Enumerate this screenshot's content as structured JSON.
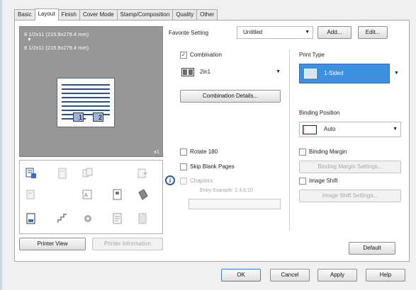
{
  "tabs": [
    "Basic",
    "Layout",
    "Finish",
    "Cover Mode",
    "Stamp/Composition",
    "Quality",
    "Other"
  ],
  "active_tab": "Layout",
  "preview": {
    "original_size": "8 1/2x11 (215.9x279.4 mm)",
    "output_size": "8 1/2x11 (215.9x279.4 mm)",
    "page_numbers": [
      "1",
      "2"
    ],
    "copies": "x1"
  },
  "favorite": {
    "label": "Favorite Setting",
    "value": "Untitled",
    "add_label": "Add...",
    "edit_label": "Edit..."
  },
  "combination": {
    "label": "Combination",
    "checked": "✓",
    "value": "2in1",
    "details_label": "Combination Details..."
  },
  "print_type": {
    "label": "Print Type",
    "value": "1-Sided"
  },
  "binding_position": {
    "label": "Binding Position",
    "value": "Auto"
  },
  "rotate_label": "Rotate 180",
  "skip_blank_label": "Skip Blank Pages",
  "chapters": {
    "label": "Chapters",
    "hint": "Entry Example: 2,4,6,10"
  },
  "binding_margin": {
    "label": "Binding Margin",
    "settings_label": "Binding Margin Settings..."
  },
  "image_shift": {
    "label": "Image Shift",
    "settings_label": "Image Shift Settings..."
  },
  "printer_view_label": "Printer View",
  "printer_info_label": "Printer Information",
  "default_label": "Default",
  "footer": {
    "ok": "OK",
    "cancel": "Cancel",
    "apply": "Apply",
    "help": "Help"
  },
  "colors": {
    "accent": "#3d8fe0",
    "preview_bg": "#979797"
  }
}
